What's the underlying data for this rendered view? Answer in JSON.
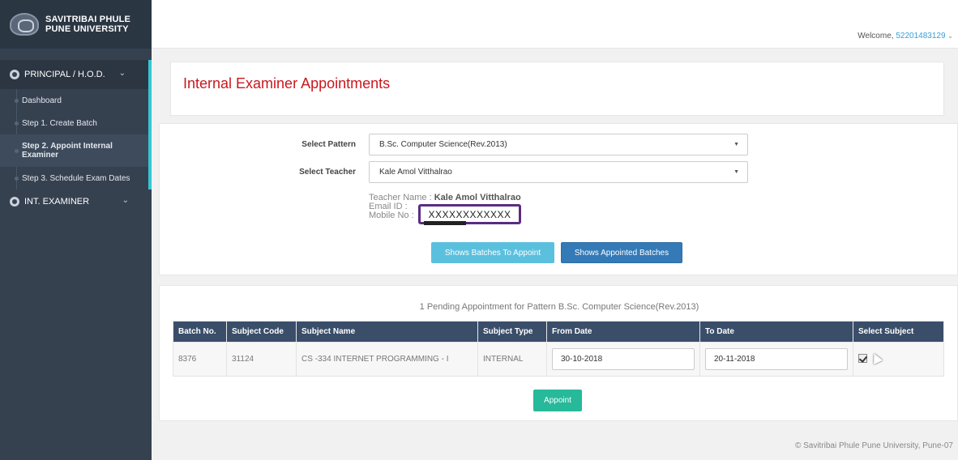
{
  "sidebar": {
    "brand": {
      "line1": "SAVITRIBAI PHULE",
      "line2": "PUNE UNIVERSITY"
    },
    "group1": {
      "label": "PRINCIPAL / H.O.D."
    },
    "items": [
      {
        "label": "Dashboard"
      },
      {
        "label": "Step 1. Create Batch"
      },
      {
        "label": "Step 2. Appoint Internal Examiner"
      },
      {
        "label": "Step 3. Schedule Exam Dates"
      }
    ],
    "group2": {
      "label": "INT. EXAMINER"
    }
  },
  "header": {
    "welcome_prefix": "Welcome, ",
    "user_id": "52201483129"
  },
  "page": {
    "title": "Internal Examiner Appointments"
  },
  "form": {
    "pattern_label": "Select Pattern",
    "pattern_value": "B.Sc. Computer Science(Rev.2013)",
    "teacher_label": "Select Teacher",
    "teacher_value": "Kale Amol Vitthalrao",
    "teacher_name_label": "Teacher Name : ",
    "teacher_name_value": "Kale Amol Vitthalrao",
    "email_label": "Email ID :",
    "email_value": "XXXXXXXXXXXX",
    "mobile_label": "Mobile No :",
    "btn_batches_to_appoint": "Shows Batches To Appoint",
    "btn_appointed_batches": "Shows Appointed Batches"
  },
  "appointments": {
    "pending_text": "1 Pending Appointment for Pattern B.Sc. Computer Science(Rev.2013)",
    "columns": [
      "Batch No.",
      "Subject Code",
      "Subject Name",
      "Subject Type",
      "From Date",
      "To Date",
      "Select Subject"
    ],
    "rows": [
      {
        "batch_no": "8376",
        "subject_code": "31124",
        "subject_name": "CS -334 INTERNET PROGRAMMING - I",
        "subject_type": "INTERNAL",
        "from_date": "30-10-2018",
        "to_date": "20-11-2018",
        "selected": true
      }
    ],
    "appoint_label": "Appoint"
  },
  "footer": {
    "text": "© Savitribai Phule Pune University, Pune-07"
  },
  "colors": {
    "sidebar_bg": "#364150",
    "accent": "#36c6d3",
    "title_red": "#c8181e",
    "table_header": "#3a4e6a",
    "appoint_green": "#26b99a",
    "btn_blue": "#337ab7",
    "btn_light_blue": "#5bc0de"
  }
}
